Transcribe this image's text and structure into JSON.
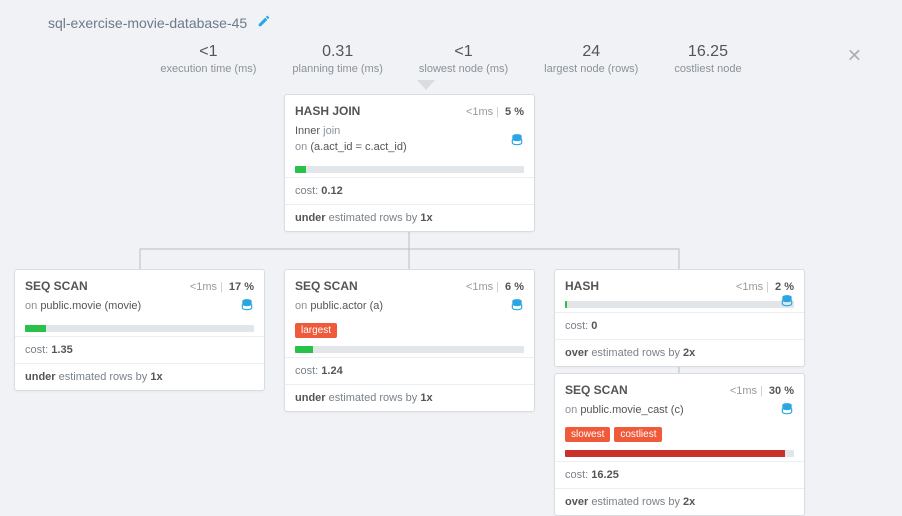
{
  "title": "sql-exercise-movie-database-45",
  "stats": {
    "exec_time": {
      "value": "<1",
      "label": "execution time (ms)"
    },
    "planning_time": {
      "value": "0.31",
      "label": "planning time (ms)"
    },
    "slowest_node": {
      "value": "<1",
      "label": "slowest node (ms)"
    },
    "largest_node": {
      "value": "24",
      "label": "largest node (rows)"
    },
    "costliest_node": {
      "value": "16.25",
      "label": "costliest node"
    }
  },
  "nodes": {
    "hashjoin": {
      "op": "HASH JOIN",
      "ms": "<1",
      "pct": "5",
      "sub1": "Inner",
      "sub1b": "join",
      "sub2_prefix": "on",
      "sub2_cond": "(a.act_id = c.act_id)",
      "bar_fill_pct": 5,
      "bar_color": "green",
      "cost_label": "cost:",
      "cost": "0.12",
      "est_dir": "under",
      "est_text": "estimated rows by",
      "est_x": "1"
    },
    "seq_movie": {
      "op": "SEQ SCAN",
      "ms": "<1",
      "pct": "17",
      "sub_prefix": "on",
      "sub_target": "public.movie (movie)",
      "bar_fill_pct": 9,
      "bar_color": "green",
      "cost_label": "cost:",
      "cost": "1.35",
      "est_dir": "under",
      "est_text": "estimated rows by",
      "est_x": "1"
    },
    "seq_actor": {
      "op": "SEQ SCAN",
      "ms": "<1",
      "pct": "6",
      "sub_prefix": "on",
      "sub_target": "public.actor (a)",
      "badges": [
        "largest"
      ],
      "bar_fill_pct": 8,
      "bar_color": "green",
      "cost_label": "cost:",
      "cost": "1.24",
      "est_dir": "under",
      "est_text": "estimated rows by",
      "est_x": "1"
    },
    "hash": {
      "op": "HASH",
      "ms": "<1",
      "pct": "2",
      "bar_fill_pct": 1,
      "bar_color": "green",
      "cost_label": "cost:",
      "cost": "0",
      "est_dir": "over",
      "est_text": "estimated rows by",
      "est_x": "2"
    },
    "seq_cast": {
      "op": "SEQ SCAN",
      "ms": "<1",
      "pct": "30",
      "sub_prefix": "on",
      "sub_target": "public.movie_cast (c)",
      "badges": [
        "slowest",
        "costliest"
      ],
      "bar_fill_pct": 96,
      "bar_color": "red",
      "cost_label": "cost:",
      "cost": "16.25",
      "est_dir": "over",
      "est_text": "estimated rows by",
      "est_x": "2"
    }
  },
  "misc": {
    "x_suffix": "x",
    "ms_suffix": "ms",
    "pct_suffix": "%"
  }
}
